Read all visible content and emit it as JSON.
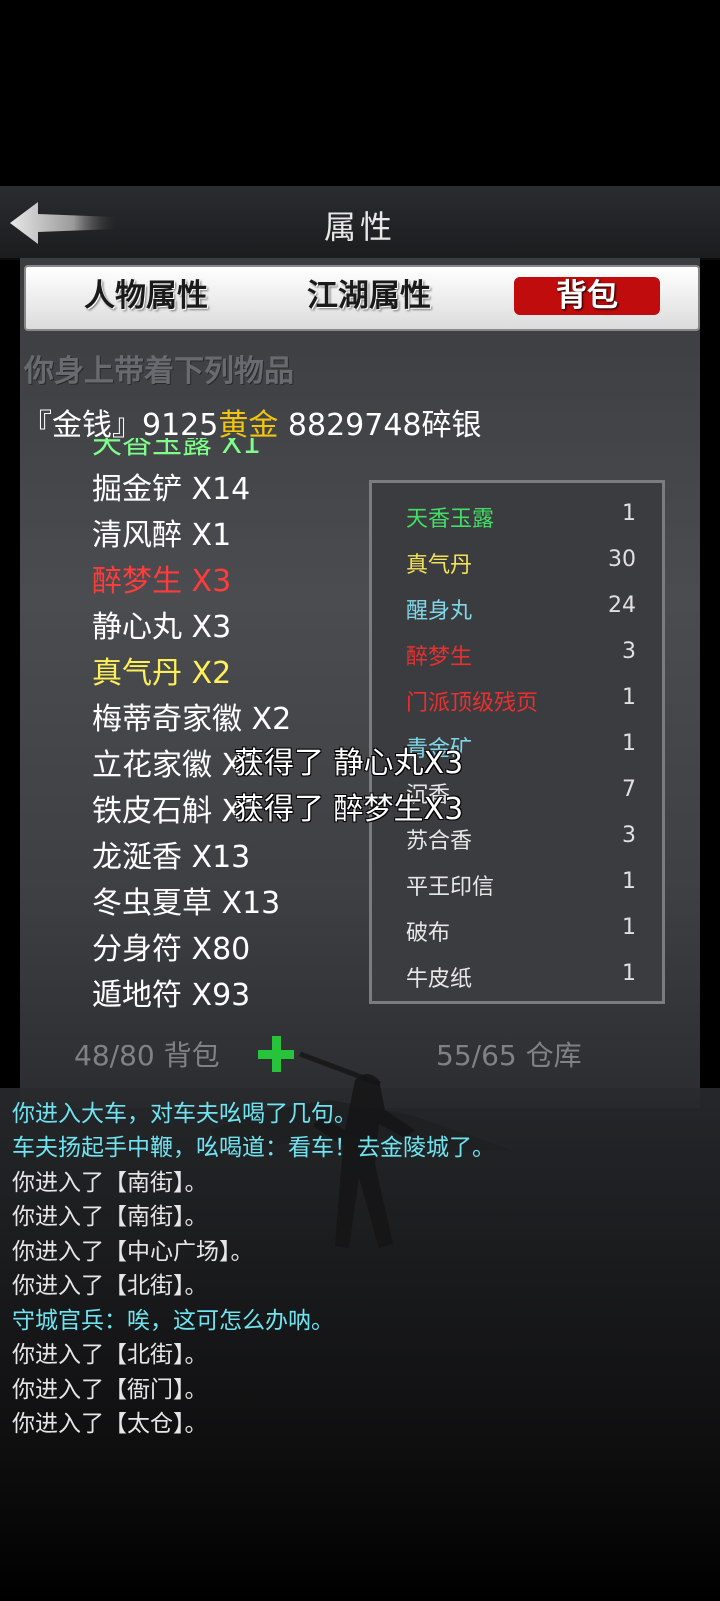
{
  "header": {
    "title": "属性"
  },
  "tabs": [
    {
      "label": "人物属性"
    },
    {
      "label": "江湖属性"
    },
    {
      "label": "背包"
    }
  ],
  "subtitle": "你身上带着下列物品",
  "money": {
    "prefix": "『金钱』9125",
    "gold_label": "黄金",
    "suffix": " 8829748碎银"
  },
  "inventory": [
    {
      "name": "天香玉露 X1",
      "color": "green",
      "partial": true
    },
    {
      "name": "掘金铲 X14",
      "color": "white"
    },
    {
      "name": "清风醉 X1",
      "color": "white"
    },
    {
      "name": "醉梦生 X3",
      "color": "red"
    },
    {
      "name": "静心丸 X3",
      "color": "white"
    },
    {
      "name": "真气丹 X2",
      "color": "yellow"
    },
    {
      "name": "梅蒂奇家徽 X2",
      "color": "white"
    },
    {
      "name": "立花家徽 X1",
      "color": "white"
    },
    {
      "name": "铁皮石斛 X1",
      "color": "white"
    },
    {
      "name": "龙涎香 X13",
      "color": "white"
    },
    {
      "name": "冬虫夏草 X13",
      "color": "white"
    },
    {
      "name": "分身符 X80",
      "color": "white"
    },
    {
      "name": "遁地符 X93",
      "color": "white"
    }
  ],
  "float_messages": [
    "获得了 静心丸X3",
    "获得了 醉梦生X3"
  ],
  "warehouse": [
    {
      "name": "天香玉露",
      "count": "1",
      "color": "#44dd66"
    },
    {
      "name": "真气丹",
      "count": "30",
      "color": "#f2e35a"
    },
    {
      "name": "醒身丸",
      "count": "24",
      "color": "#7fd7e8"
    },
    {
      "name": "醉梦生",
      "count": "3",
      "color": "#e83030"
    },
    {
      "name": "门派顶级残页",
      "count": "1",
      "color": "#e83030"
    },
    {
      "name": "青金矿",
      "count": "1",
      "color": "#7fd7e8"
    },
    {
      "name": "沉香",
      "count": "7",
      "color": "#e8e8e8"
    },
    {
      "name": "苏合香",
      "count": "3",
      "color": "#e8e8e8"
    },
    {
      "name": "平王印信",
      "count": "1",
      "color": "#e8e8e8"
    },
    {
      "name": "破布",
      "count": "1",
      "color": "#e8e8e8"
    },
    {
      "name": "牛皮纸",
      "count": "1",
      "color": "#e8e8e8"
    }
  ],
  "capacity": {
    "bag": "48/80 背包",
    "warehouse": "55/65 仓库"
  },
  "log": [
    {
      "text": "你进入大车，对车夫吆喝了几句。",
      "color": "cyan"
    },
    {
      "text": "车夫扬起手中鞭，吆喝道：看车！去金陵城了。",
      "color": "cyan"
    },
    {
      "text": "你进入了【南街】。",
      "color": "white"
    },
    {
      "text": "你进入了【南街】。",
      "color": "white"
    },
    {
      "text": "你进入了【中心广场】。",
      "color": "white"
    },
    {
      "text": "你进入了【北街】。",
      "color": "white"
    },
    {
      "text": "守城官兵：唉，这可怎么办呐。",
      "color": "cyan"
    },
    {
      "text": "你进入了【北街】。",
      "color": "white"
    },
    {
      "text": "你进入了【衙门】。",
      "color": "white"
    },
    {
      "text": "你进入了【太仓】。",
      "color": "white"
    }
  ]
}
